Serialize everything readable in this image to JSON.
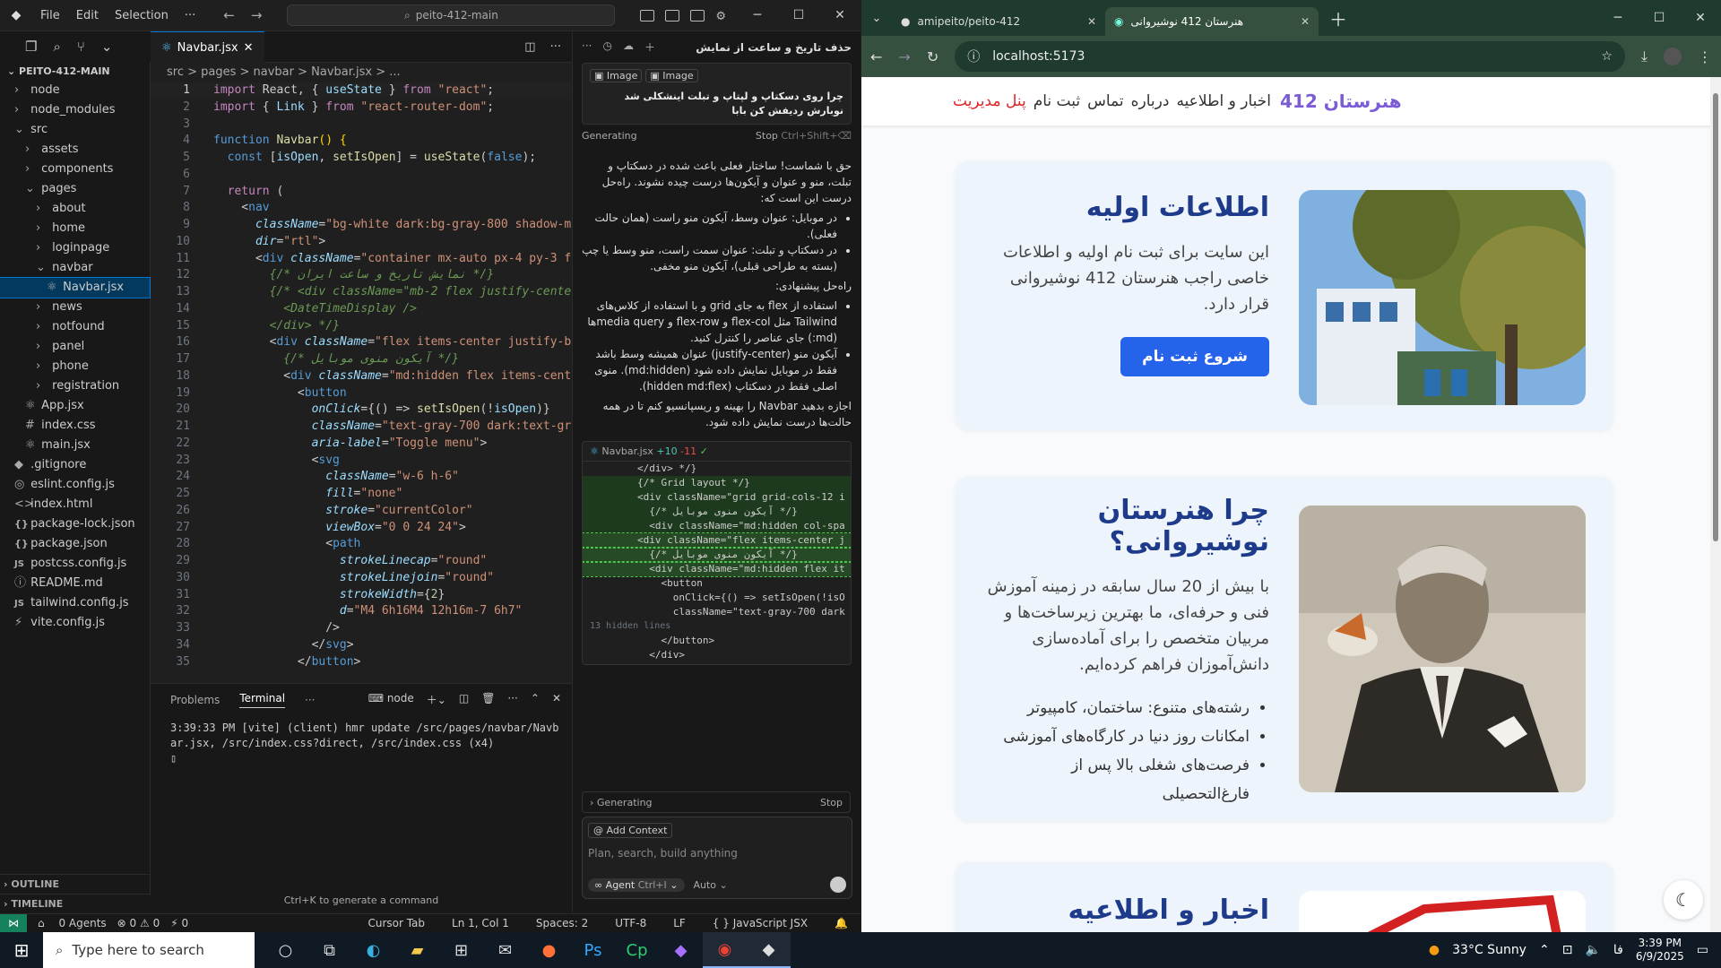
{
  "editor": {
    "menu": [
      "File",
      "Edit",
      "Selection",
      "···"
    ],
    "search": "peito-412-main",
    "explorer": {
      "root": "PEITO-412-MAIN",
      "items": [
        {
          "label": "node",
          "indent": 1,
          "kind": "folder"
        },
        {
          "label": "node_modules",
          "indent": 1,
          "kind": "folder"
        },
        {
          "label": "src",
          "indent": 1,
          "kind": "folder-open"
        },
        {
          "label": "assets",
          "indent": 2,
          "kind": "folder"
        },
        {
          "label": "components",
          "indent": 2,
          "kind": "folder"
        },
        {
          "label": "pages",
          "indent": 2,
          "kind": "folder-open"
        },
        {
          "label": "about",
          "indent": 3,
          "kind": "folder"
        },
        {
          "label": "home",
          "indent": 3,
          "kind": "folder"
        },
        {
          "label": "loginpage",
          "indent": 3,
          "kind": "folder"
        },
        {
          "label": "navbar",
          "indent": 3,
          "kind": "folder-open"
        },
        {
          "label": "Navbar.jsx",
          "indent": 4,
          "kind": "jsx",
          "selected": true
        },
        {
          "label": "news",
          "indent": 3,
          "kind": "folder"
        },
        {
          "label": "notfound",
          "indent": 3,
          "kind": "folder"
        },
        {
          "label": "panel",
          "indent": 3,
          "kind": "folder"
        },
        {
          "label": "phone",
          "indent": 3,
          "kind": "folder"
        },
        {
          "label": "registration",
          "indent": 3,
          "kind": "folder"
        },
        {
          "label": "App.jsx",
          "indent": 2,
          "kind": "jsx"
        },
        {
          "label": "index.css",
          "indent": 2,
          "kind": "css"
        },
        {
          "label": "main.jsx",
          "indent": 2,
          "kind": "jsx"
        },
        {
          "label": ".gitignore",
          "indent": 1,
          "kind": "git"
        },
        {
          "label": "eslint.config.js",
          "indent": 1,
          "kind": "es"
        },
        {
          "label": "index.html",
          "indent": 1,
          "kind": "html"
        },
        {
          "label": "package-lock.json",
          "indent": 1,
          "kind": "json"
        },
        {
          "label": "package.json",
          "indent": 1,
          "kind": "json"
        },
        {
          "label": "postcss.config.js",
          "indent": 1,
          "kind": "js"
        },
        {
          "label": "README.md",
          "indent": 1,
          "kind": "md"
        },
        {
          "label": "tailwind.config.js",
          "indent": 1,
          "kind": "js"
        },
        {
          "label": "vite.config.js",
          "indent": 1,
          "kind": "vite"
        }
      ],
      "outline": "OUTLINE",
      "timeline": "TIMELINE"
    },
    "tab": "Navbar.jsx",
    "breadcrumb": "src > pages > navbar > Navbar.jsx > ...",
    "code": [
      [
        [
          "kw",
          "import"
        ],
        [
          "",
          " React, { "
        ],
        [
          "var",
          "useState"
        ],
        [
          "",
          " } "
        ],
        [
          "kw",
          "from"
        ],
        [
          "",
          " "
        ],
        [
          "str",
          "\"react\""
        ],
        [
          "",
          ";"
        ]
      ],
      [
        [
          "kw",
          "import"
        ],
        [
          "",
          " { "
        ],
        [
          "var",
          "Link"
        ],
        [
          "",
          " } "
        ],
        [
          "kw",
          "from"
        ],
        [
          "",
          " "
        ],
        [
          "str",
          "\"react-router-dom\""
        ],
        [
          "",
          ";"
        ]
      ],
      [],
      [
        [
          "kw2",
          "function"
        ],
        [
          "",
          " "
        ],
        [
          "fn",
          "Navbar"
        ],
        [
          "pn",
          "()"
        ],
        [
          "",
          " "
        ],
        [
          "pn",
          "{"
        ]
      ],
      [
        [
          "",
          "  "
        ],
        [
          "kw2",
          "const"
        ],
        [
          "",
          " ["
        ],
        [
          "var",
          "isOpen"
        ],
        [
          "",
          ", "
        ],
        [
          "fn",
          "setIsOpen"
        ],
        [
          "",
          "] = "
        ],
        [
          "fn",
          "useState"
        ],
        [
          "",
          "("
        ],
        [
          "kw2",
          "false"
        ],
        [
          "",
          ");"
        ]
      ],
      [],
      [
        [
          "",
          "  "
        ],
        [
          "kw",
          "return"
        ],
        [
          "",
          " ("
        ]
      ],
      [
        [
          "",
          "    <"
        ],
        [
          "tag",
          "nav"
        ]
      ],
      [
        [
          "",
          "      "
        ],
        [
          "attr",
          "className"
        ],
        [
          "",
          "="
        ],
        [
          "str",
          "\"bg-white dark:bg-gray-800 shadow-m"
        ]
      ],
      [
        [
          "",
          "      "
        ],
        [
          "attr",
          "dir"
        ],
        [
          "",
          "="
        ],
        [
          "str",
          "\"rtl\""
        ],
        [
          "",
          ">"
        ]
      ],
      [
        [
          "",
          "      <"
        ],
        [
          "tag",
          "div"
        ],
        [
          "",
          " "
        ],
        [
          "attr",
          "className"
        ],
        [
          "",
          "="
        ],
        [
          "str",
          "\"container mx-auto px-4 py-3 f"
        ]
      ],
      [
        [
          "",
          "        "
        ],
        [
          "cm",
          "{/* نمایش تاریخ و ساعت ایران */}"
        ]
      ],
      [
        [
          "",
          "        "
        ],
        [
          "cm",
          "{/* <div className=\"mb-2 flex justify-cente"
        ]
      ],
      [
        [
          "",
          "          "
        ],
        [
          "cm",
          "<DateTimeDisplay />"
        ]
      ],
      [
        [
          "",
          "        "
        ],
        [
          "cm",
          "</div> */}"
        ]
      ],
      [
        [
          "",
          "        <"
        ],
        [
          "tag",
          "div"
        ],
        [
          "",
          " "
        ],
        [
          "attr",
          "className"
        ],
        [
          "",
          "="
        ],
        [
          "str",
          "\"flex items-center justify-b"
        ]
      ],
      [
        [
          "",
          "          "
        ],
        [
          "cm",
          "{/* آیکون منوی موبایل */}"
        ]
      ],
      [
        [
          "",
          "          <"
        ],
        [
          "tag",
          "div"
        ],
        [
          "",
          " "
        ],
        [
          "attr",
          "className"
        ],
        [
          "",
          "="
        ],
        [
          "str",
          "\"md:hidden flex items-cent"
        ]
      ],
      [
        [
          "",
          "            <"
        ],
        [
          "tag",
          "button"
        ]
      ],
      [
        [
          "",
          "              "
        ],
        [
          "attr",
          "onClick"
        ],
        [
          "",
          "={() => "
        ],
        [
          "fn",
          "setIsOpen"
        ],
        [
          "",
          "(!"
        ],
        [
          "var",
          "isOpen"
        ],
        [
          "",
          ")}"
        ]
      ],
      [
        [
          "",
          "              "
        ],
        [
          "attr",
          "className"
        ],
        [
          "",
          "="
        ],
        [
          "str",
          "\"text-gray-700 dark:text-gr"
        ]
      ],
      [
        [
          "",
          "              "
        ],
        [
          "attr",
          "aria-label"
        ],
        [
          "",
          "="
        ],
        [
          "str",
          "\"Toggle menu\""
        ],
        [
          "",
          ">"
        ]
      ],
      [
        [
          "",
          "              <"
        ],
        [
          "tag",
          "svg"
        ]
      ],
      [
        [
          "",
          "                "
        ],
        [
          "attr",
          "className"
        ],
        [
          "",
          "="
        ],
        [
          "str",
          "\"w-6 h-6\""
        ]
      ],
      [
        [
          "",
          "                "
        ],
        [
          "attr",
          "fill"
        ],
        [
          "",
          "="
        ],
        [
          "str",
          "\"none\""
        ]
      ],
      [
        [
          "",
          "                "
        ],
        [
          "attr",
          "stroke"
        ],
        [
          "",
          "="
        ],
        [
          "str",
          "\"currentColor\""
        ]
      ],
      [
        [
          "",
          "                "
        ],
        [
          "attr",
          "viewBox"
        ],
        [
          "",
          "="
        ],
        [
          "str",
          "\"0 0 24 24\""
        ],
        [
          "",
          ">"
        ]
      ],
      [
        [
          "",
          "                <"
        ],
        [
          "tag",
          "path"
        ]
      ],
      [
        [
          "",
          "                  "
        ],
        [
          "attr",
          "strokeLinecap"
        ],
        [
          "",
          "="
        ],
        [
          "str",
          "\"round\""
        ]
      ],
      [
        [
          "",
          "                  "
        ],
        [
          "attr",
          "strokeLinejoin"
        ],
        [
          "",
          "="
        ],
        [
          "str",
          "\"round\""
        ]
      ],
      [
        [
          "",
          "                  "
        ],
        [
          "attr",
          "strokeWidth"
        ],
        [
          "",
          "={"
        ],
        [
          "num",
          "2"
        ],
        [
          "",
          "}"
        ]
      ],
      [
        [
          "",
          "                  "
        ],
        [
          "attr",
          "d"
        ],
        [
          "",
          "="
        ],
        [
          "str",
          "\"M4 6h16M4 12h16m-7 6h7\""
        ]
      ],
      [
        [
          "",
          "                />"
        ]
      ],
      [
        [
          "",
          "              </"
        ],
        [
          "tag",
          "svg"
        ],
        [
          "",
          ">"
        ]
      ],
      [
        [
          "",
          "            </"
        ],
        [
          "tag",
          "button"
        ],
        [
          "",
          ">"
        ]
      ]
    ],
    "panel": {
      "tabs": [
        "Problems",
        "Terminal",
        "···"
      ],
      "node": "node",
      "term1": "3:39:33 PM [vite] (client) hmr update /src/pages/navbar/Navb",
      "term2": "ar.jsx, /src/index.css?direct, /src/index.css (x4)"
    },
    "cmd_hint": "Ctrl+K to generate a command",
    "status": {
      "agents": "0 Agents",
      "errors": "⊗ 0 ⚠ 0",
      "ports": "⚡ 0",
      "cursor_tab": "Cursor Tab",
      "pos": "Ln 1, Col 1",
      "spaces": "Spaces: 2",
      "enc": "UTF-8",
      "eol": "LF",
      "lang": "{ } JavaScript JSX"
    }
  },
  "chat": {
    "title": "حذف تاریخ و ساعت از نمایش",
    "chips": [
      "Image",
      "Image"
    ],
    "question": "چرا روی دسکتاپ و لپتاپ و تبلت اینشکلی شد نوبارش ردیفش کن بابا",
    "generating": "Generating",
    "stop": "Stop",
    "stop_key": "Ctrl+Shift+⌫",
    "answer_intro": "حق با شماست! ساختار فعلی باعث شده در دسکتاپ و تبلت، منو و عنوان و آیکون‌ها درست چیده نشوند. راه‌حل درست این است که:",
    "answer_points": [
      "در موبایل: عنوان وسط، آیکون منو راست (همان حالت فعلی).",
      "در دسکتاپ و تبلت: عنوان سمت راست، منو وسط یا چپ (بسته به طراحی قبلی)، آیکون منو مخفی."
    ],
    "solution_title": "راه‌حل پیشنهادی:",
    "solution_points": [
      "استفاده از flex به جای grid و با استفاده از کلاس‌های Tailwind مثل flex-col و flex-row و media queryها (md:) جای عناصر را کنترل کنید.",
      "آیکون منو (justify-center) عنوان همیشه وسط باشد فقط در موبایل نمایش داده شود (md:hidden). منوی اصلی فقط در دسکتاپ (hidden md:flex)."
    ],
    "answer_outro": "اجازه بدهید Navbar را بهینه و ریسپانسیو کنم تا در همه حالت‌ها درست نمایش داده شود.",
    "diff_file": "Navbar.jsx",
    "diff_add": "+10",
    "diff_rem": "-11",
    "diff_lines": [
      {
        "t": "        </div> */}",
        "k": ""
      },
      {
        "t": "        {/* Grid layout */}",
        "k": "add"
      },
      {
        "t": "        <div className=\"grid grid-cols-12 i",
        "k": "add"
      },
      {
        "t": "          {/* آیکون منوی موبایل */}",
        "k": "add"
      },
      {
        "t": "          <div className=\"md:hidden col-spa",
        "k": "add"
      },
      {
        "t": "        <div className=\"flex items-center j",
        "k": "sel"
      },
      {
        "t": "          {/* آیکون منوی موبایل */}",
        "k": "sel"
      },
      {
        "t": "          <div className=\"md:hidden flex it",
        "k": "sel"
      },
      {
        "t": "            <button",
        "k": ""
      },
      {
        "t": "              onClick={() => setIsOpen(!isO",
        "k": ""
      },
      {
        "t": "              className=\"text-gray-700 dark",
        "k": ""
      },
      {
        "t": "13 hidden lines",
        "k": "hid"
      },
      {
        "t": "            </button>",
        "k": ""
      },
      {
        "t": "          </div>",
        "k": ""
      }
    ],
    "gen2": "Generating",
    "stop2": "Stop",
    "add_context": "Add Context",
    "placeholder": "Plan, search, build anything",
    "agent": "Agent",
    "agent_key": "Ctrl+I",
    "auto": "Auto"
  },
  "browser": {
    "tab1": "amipeito/peito-412",
    "tab2": "هنرستان 412 نوشیروانی",
    "url": "localhost:5173",
    "site": {
      "brand": "هنرستان 412",
      "nav": [
        "اخبار و اطلاعیه",
        "درباره",
        "تماس",
        "ثبت نام",
        "پنل مدیریت"
      ],
      "card1": {
        "title": "اطلاعات اولیه",
        "text": "این سایت برای ثبت نام اولیه و اطلاعات خاصی راجب هنرستان 412 نوشیروانی قرار دارد.",
        "btn": "شروع ثبت نام"
      },
      "card2": {
        "title": "چرا هنرستان نوشیروانی؟",
        "text": "با بیش از 20 سال سابقه در زمینه آموزش فنی و حرفه‌ای، ما بهترین زیرساخت‌ها و مربیان متخصص را برای آماده‌سازی دانش‌آموزان فراهم کرده‌ایم.",
        "list": [
          "رشته‌های متنوع: ساختمان، کامپیوتر",
          "امکانات روز دنیا در کارگاه‌های آموزشی",
          "فرصت‌های شغلی بالا پس از فارغ‌التحصیلی"
        ]
      },
      "card3": {
        "title": "اخبار و اطلاعیه"
      }
    }
  },
  "taskbar": {
    "search": "Type here to search",
    "weather": "33°C  Sunny",
    "lang": "فا",
    "time": "3:39 PM",
    "date": "6/9/2025"
  }
}
